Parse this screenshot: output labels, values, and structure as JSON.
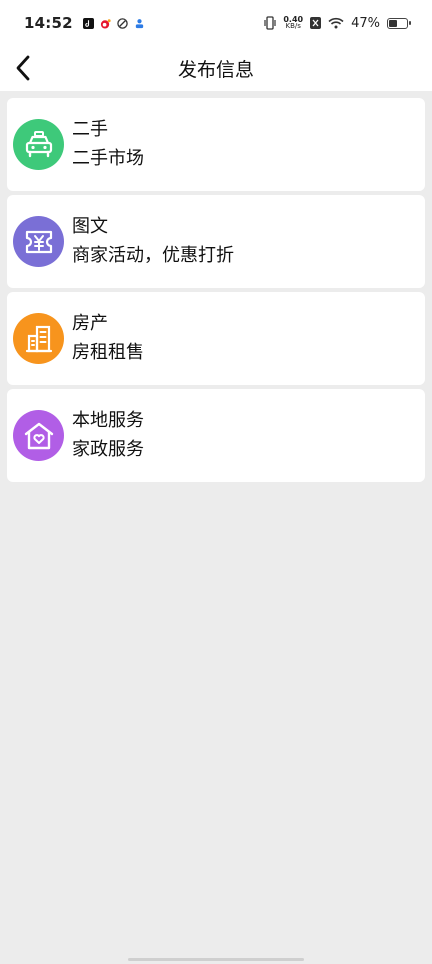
{
  "status_bar": {
    "time": "14:52",
    "speed_value": "0.40",
    "speed_unit": "KB/s",
    "battery_percent_text": "47%",
    "battery_level": 0.47
  },
  "header": {
    "title": "发布信息",
    "back_icon": "chevron-left-icon"
  },
  "categories": [
    {
      "title": "二手",
      "subtitle": "二手市场",
      "icon": "car-icon",
      "color": "#3ec97a"
    },
    {
      "title": "图文",
      "subtitle": "商家活动，优惠打折",
      "icon": "coupon-icon",
      "color": "#7a6fd6"
    },
    {
      "title": "房产",
      "subtitle": "房租租售",
      "icon": "building-icon",
      "color": "#f7941d"
    },
    {
      "title": "本地服务",
      "subtitle": "家政服务",
      "icon": "home-heart-icon",
      "color": "#b15ee6"
    }
  ]
}
